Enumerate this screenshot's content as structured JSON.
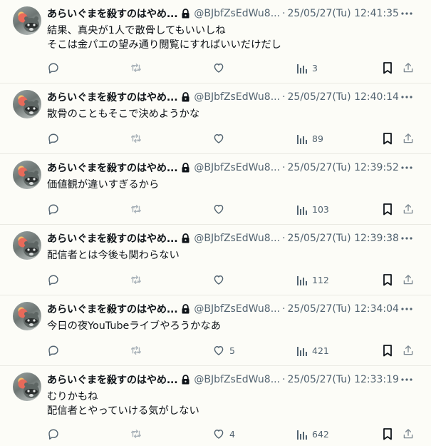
{
  "tweets": [
    {
      "name": "あらいぐまを殺すのはやめ...",
      "handle": "@BJbfZsEdWu8...",
      "separator": "·",
      "time": "25/05/27(Tu) 12:41:35",
      "lines": [
        "結果、真央が1人で散骨してもいいしね",
        "そこは金パエの望み通り閲覧にすればいいだけだし"
      ],
      "likes": "",
      "views": "3"
    },
    {
      "name": "あらいぐまを殺すのはやめ...",
      "handle": "@BJbfZsEdWu8...",
      "separator": "·",
      "time": "25/05/27(Tu) 12:40:14",
      "lines": [
        "散骨のこともそこで決めようかな"
      ],
      "likes": "",
      "views": "89"
    },
    {
      "name": "あらいぐまを殺すのはやめ...",
      "handle": "@BJbfZsEdWu8...",
      "separator": "·",
      "time": "25/05/27(Tu) 12:39:52",
      "lines": [
        "価値観が違いすぎるから"
      ],
      "likes": "",
      "views": "103"
    },
    {
      "name": "あらいぐまを殺すのはやめ...",
      "handle": "@BJbfZsEdWu8...",
      "separator": "·",
      "time": "25/05/27(Tu) 12:39:38",
      "lines": [
        "配信者とは今後も関わらない"
      ],
      "likes": "",
      "views": "112"
    },
    {
      "name": "あらいぐまを殺すのはやめ...",
      "handle": "@BJbfZsEdWu8...",
      "separator": "·",
      "time": "25/05/27(Tu) 12:34:04",
      "lines": [
        "今日の夜YouTubeライブやろうかなあ"
      ],
      "likes": "5",
      "views": "421"
    },
    {
      "name": "あらいぐまを殺すのはやめ...",
      "handle": "@BJbfZsEdWu8...",
      "separator": "·",
      "time": "25/05/27(Tu) 12:33:19",
      "lines": [
        "むりかもね",
        "配信者とやっていける気がしない"
      ],
      "likes": "4",
      "views": "642"
    }
  ],
  "icons": {
    "more": "more-dots-icon",
    "reply": "reply-icon",
    "retweet": "retweet-icon",
    "like": "heart-icon",
    "views": "views-icon",
    "bookmark": "bookmark-icon",
    "share": "share-icon",
    "lock": "lock-icon"
  },
  "colors": {
    "background": "#fcfcf7",
    "text": "#0f1419",
    "secondary": "#536471",
    "retweet_icon": "#a9b2b9",
    "divider": "#eaeae3"
  }
}
